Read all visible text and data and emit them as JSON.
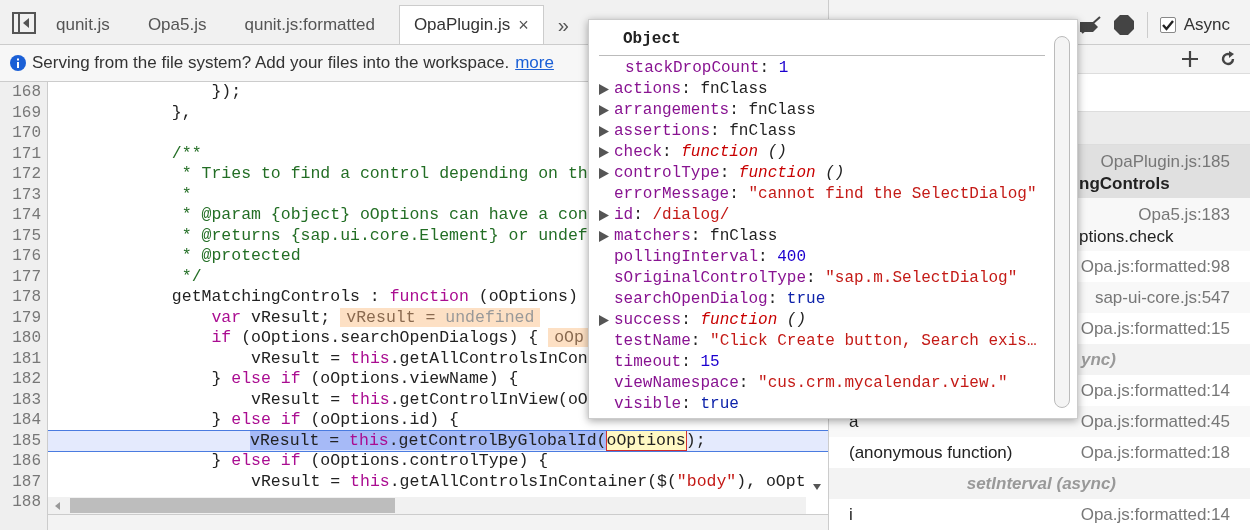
{
  "tabs": [
    {
      "label": "qunit.js",
      "selected": false
    },
    {
      "label": "Opa5.js",
      "selected": false
    },
    {
      "label": "qunit.js:formatted",
      "selected": false
    },
    {
      "label": "OpaPlugin.js",
      "selected": true,
      "close": "×"
    }
  ],
  "more_tabs": "»",
  "infobar": {
    "text": "Serving from the file system? Add your files into the workspace.",
    "link": "more"
  },
  "code": {
    "lines": [
      {
        "number": "168",
        "current": false,
        "segments": [
          {
            "kind": "plain",
            "text": "                });"
          }
        ]
      },
      {
        "number": "169",
        "current": false,
        "segments": [
          {
            "kind": "plain",
            "text": "            },"
          }
        ]
      },
      {
        "number": "170",
        "current": false
      },
      {
        "number": "171",
        "current": false,
        "segments": [
          {
            "kind": "comment",
            "text": "            /**"
          }
        ]
      },
      {
        "number": "172",
        "current": false,
        "segments": [
          {
            "kind": "comment",
            "text": "             * Tries to find a control depending on th"
          }
        ]
      },
      {
        "number": "173",
        "current": false,
        "segments": [
          {
            "kind": "comment",
            "text": "             *"
          }
        ]
      },
      {
        "number": "174",
        "current": false,
        "segments": [
          {
            "kind": "comment",
            "text": "             * @param {object} oOptions can have a con"
          }
        ]
      },
      {
        "number": "175",
        "current": false,
        "segments": [
          {
            "kind": "comment",
            "text": "             * @returns {sap.ui.core.Element} or undef"
          }
        ]
      },
      {
        "number": "176",
        "current": false,
        "segments": [
          {
            "kind": "comment",
            "text": "             * @protected"
          }
        ]
      },
      {
        "number": "177",
        "current": false,
        "segments": [
          {
            "kind": "comment",
            "text": "             */"
          }
        ]
      },
      {
        "number": "178",
        "current": false,
        "segments": [
          {
            "kind": "plain",
            "text": "            getMatchingControls : "
          },
          {
            "kind": "keyword",
            "text": "function"
          },
          {
            "kind": "plain",
            "text": " (oOptions)"
          }
        ]
      },
      {
        "number": "179",
        "current": false,
        "segments": [
          {
            "kind": "keyword",
            "text": "                var"
          },
          {
            "kind": "plain",
            "text": " vResult;"
          },
          {
            "kind": "inline_value",
            "name": "vResult =",
            "value": "undefined"
          }
        ]
      },
      {
        "number": "180",
        "current": false,
        "segments": [
          {
            "kind": "keyword",
            "text": "                if"
          },
          {
            "kind": "plain",
            "text": " (oOptions.searchOpenDialogs) {"
          },
          {
            "kind": "inline_value",
            "name": "oOp"
          }
        ]
      },
      {
        "number": "181",
        "current": false,
        "segments": [
          {
            "kind": "plain",
            "text": "                    vResult = "
          },
          {
            "kind": "keyword",
            "text": "this"
          },
          {
            "kind": "plain",
            "text": ".getAllControlsInCon"
          }
        ]
      },
      {
        "number": "182",
        "current": false,
        "segments": [
          {
            "kind": "plain",
            "text": "                } "
          },
          {
            "kind": "keyword",
            "text": "else if"
          },
          {
            "kind": "plain",
            "text": " (oOptions.viewName) {"
          }
        ]
      },
      {
        "number": "183",
        "current": false,
        "segments": [
          {
            "kind": "plain",
            "text": "                    vResult = "
          },
          {
            "kind": "keyword",
            "text": "this"
          },
          {
            "kind": "plain",
            "text": ".getControlInView(oO"
          }
        ]
      },
      {
        "number": "184",
        "current": false,
        "segments": [
          {
            "kind": "plain",
            "text": "                } "
          },
          {
            "kind": "keyword",
            "text": "else if"
          },
          {
            "kind": "plain",
            "text": " (oOptions.id) {"
          }
        ]
      },
      {
        "number": "185",
        "current": true,
        "segments": [
          {
            "kind": "plain",
            "text": "                    vResult = ",
            "in_selection": true,
            "hovered": false
          },
          {
            "kind": "keyword",
            "text": "this",
            "in_selection": true,
            "hovered": false
          },
          {
            "kind": "plain",
            "text": ".getControlByGlobalId(",
            "in_selection": true,
            "hovered": false
          },
          {
            "kind": "plain",
            "text": "oOptions",
            "in_selection": false,
            "hovered": true
          },
          {
            "kind": "plain",
            "text": ");",
            "in_selection": false,
            "hovered": false
          }
        ]
      },
      {
        "number": "186",
        "current": false,
        "segments": [
          {
            "kind": "plain",
            "text": "                } "
          },
          {
            "kind": "keyword",
            "text": "else if"
          },
          {
            "kind": "plain",
            "text": " (oOptions.controlType) {"
          }
        ]
      },
      {
        "number": "187",
        "current": false,
        "segments": [
          {
            "kind": "plain",
            "text": "                    vResult = "
          },
          {
            "kind": "keyword",
            "text": "this"
          },
          {
            "kind": "plain",
            "text": ".getAllControlsInContainer($("
          },
          {
            "kind": "string",
            "text": "\"body\""
          },
          {
            "kind": "plain",
            "text": "), oOpt"
          }
        ]
      },
      {
        "number": "188",
        "current": false
      }
    ]
  },
  "popover": {
    "title": "Object",
    "properties": [
      {
        "key": "stackDropCount",
        "separator": ":",
        "value": "1",
        "kind": "number",
        "expandable": false
      },
      {
        "key": "actions",
        "separator": ":",
        "value": "fnClass",
        "kind": "object",
        "expandable": true
      },
      {
        "key": "arrangements",
        "separator": ":",
        "value": "fnClass",
        "kind": "object",
        "expandable": true
      },
      {
        "key": "assertions",
        "separator": ":",
        "value": "fnClass",
        "kind": "object",
        "expandable": true
      },
      {
        "key": "check",
        "separator": ":",
        "value": "function",
        "args": "()",
        "kind": "function",
        "expandable": true
      },
      {
        "key": "controlType",
        "separator": ":",
        "value": "function",
        "args": "()",
        "kind": "function",
        "expandable": true
      },
      {
        "key": "errorMessage",
        "separator": ":",
        "value": "\"cannot find the SelectDialog\"",
        "kind": "string",
        "expandable": false
      },
      {
        "key": "id",
        "separator": ":",
        "value": "/dialog/",
        "kind": "regexp",
        "expandable": true
      },
      {
        "key": "matchers",
        "separator": ":",
        "value": "fnClass",
        "kind": "object",
        "expandable": true
      },
      {
        "key": "pollingInterval",
        "separator": ":",
        "value": "400",
        "kind": "number",
        "expandable": false
      },
      {
        "key": "sOriginalControlType",
        "separator": ":",
        "value": "\"sap.m.SelectDialog\"",
        "kind": "string",
        "expandable": false
      },
      {
        "key": "searchOpenDialog",
        "separator": ":",
        "value": "true",
        "kind": "boolean",
        "expandable": false
      },
      {
        "key": "success",
        "separator": ":",
        "value": "function",
        "args": "()",
        "kind": "function",
        "expandable": true
      },
      {
        "key": "testName",
        "separator": ":",
        "value": "\"Click Create button, Search exis…",
        "kind": "string",
        "expandable": false
      },
      {
        "key": "timeout",
        "separator": ":",
        "value": "15",
        "kind": "number",
        "expandable": false
      },
      {
        "key": "viewNamespace",
        "separator": ":",
        "value": "\"cus.crm.mycalendar.view.\"",
        "kind": "string",
        "expandable": false
      },
      {
        "key": "visible",
        "separator": ":",
        "value": "true",
        "kind": "boolean",
        "expandable": false
      }
    ]
  },
  "debugger": {
    "async": {
      "label": "Async",
      "checked": true
    },
    "call_stack": [
      {
        "kind": "wrapped_frame",
        "name": "ngControls",
        "location": "OpaPlugin.js:185",
        "selected": true
      },
      {
        "kind": "wrapped_frame",
        "name": "ptions.check",
        "location": "Opa5.js:183",
        "selected": false
      },
      {
        "kind": "frame",
        "location": "Opa.js:formatted:98",
        "selected": false
      },
      {
        "kind": "frame",
        "location": "sap-ui-core.js:547",
        "selected": false
      },
      {
        "kind": "frame",
        "location": "Opa.js:formatted:15",
        "selected": false
      },
      {
        "kind": "async",
        "label": "ync)"
      },
      {
        "kind": "frame",
        "location": "Opa.js:formatted:14",
        "selected": false
      },
      {
        "kind": "frame",
        "name": "a",
        "location": "Opa.js:formatted:45",
        "selected": false
      },
      {
        "kind": "frame",
        "name": "(anonymous function)",
        "location": "Opa.js:formatted:18",
        "selected": false
      },
      {
        "kind": "async",
        "label": "setInterval (async)"
      },
      {
        "kind": "frame",
        "name": "i",
        "location": "Opa.js:formatted:14",
        "selected": false
      }
    ]
  }
}
